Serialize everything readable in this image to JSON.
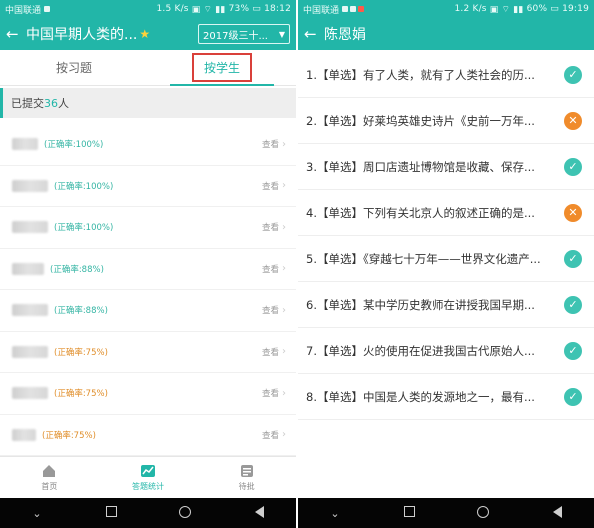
{
  "left": {
    "status": {
      "carrier": "中国联通",
      "speed": "1.5 K/s",
      "battery": "73%",
      "time": "18:12"
    },
    "header": {
      "title": "中国早期人类的...",
      "class_select": "2017级三十..."
    },
    "tabs": [
      {
        "label": "按习题"
      },
      {
        "label": "按学生"
      }
    ],
    "submitted": {
      "prefix": "已提交",
      "count": "36",
      "suffix": "人"
    },
    "students": [
      {
        "accuracy": "(正确率:100%)",
        "view": "查看",
        "level": "high"
      },
      {
        "accuracy": "(正确率:100%)",
        "view": "查看",
        "level": "high"
      },
      {
        "accuracy": "(正确率:100%)",
        "view": "查看",
        "level": "high"
      },
      {
        "accuracy": "(正确率:88%)",
        "view": "查看",
        "level": "high"
      },
      {
        "accuracy": "(正确率:88%)",
        "view": "查看",
        "level": "high"
      },
      {
        "accuracy": "(正确率:75%)",
        "view": "查看",
        "level": "mid"
      },
      {
        "accuracy": "(正确率:75%)",
        "view": "查看",
        "level": "mid"
      },
      {
        "accuracy": "(正确率:75%)",
        "view": "查看",
        "level": "mid"
      }
    ],
    "bottom_nav": [
      {
        "label": "首页",
        "icon": "home-icon"
      },
      {
        "label": "答题统计",
        "icon": "stats-icon"
      },
      {
        "label": "待批",
        "icon": "grading-icon"
      }
    ]
  },
  "right": {
    "status": {
      "carrier": "中国联通",
      "speed": "1.2 K/s",
      "battery": "60%",
      "time": "19:19"
    },
    "header": {
      "title": "陈恩娟"
    },
    "questions": [
      {
        "text": "1.【单选】有了人类，就有了人类社会的历...",
        "status": "correct"
      },
      {
        "text": "2.【单选】好莱坞英雄史诗片《史前一万年...",
        "status": "wrong"
      },
      {
        "text": "3.【单选】周口店遗址博物馆是收藏、保存...",
        "status": "correct"
      },
      {
        "text": "4.【单选】下列有关北京人的叙述正确的是...",
        "status": "wrong"
      },
      {
        "text": "5.【单选】《穿越七十万年——世界文化遗产...",
        "status": "correct"
      },
      {
        "text": "6.【单选】某中学历史教师在讲授我国早期...",
        "status": "correct"
      },
      {
        "text": "7.【单选】火的使用在促进我国古代原始人...",
        "status": "correct"
      },
      {
        "text": "8.【单选】中国是人类的发源地之一，最有...",
        "status": "correct"
      }
    ]
  },
  "colors": {
    "accent": "#22b6a8",
    "correct": "#3ec3b2",
    "wrong": "#f08b2b",
    "highlight_box": "#d9403a"
  }
}
